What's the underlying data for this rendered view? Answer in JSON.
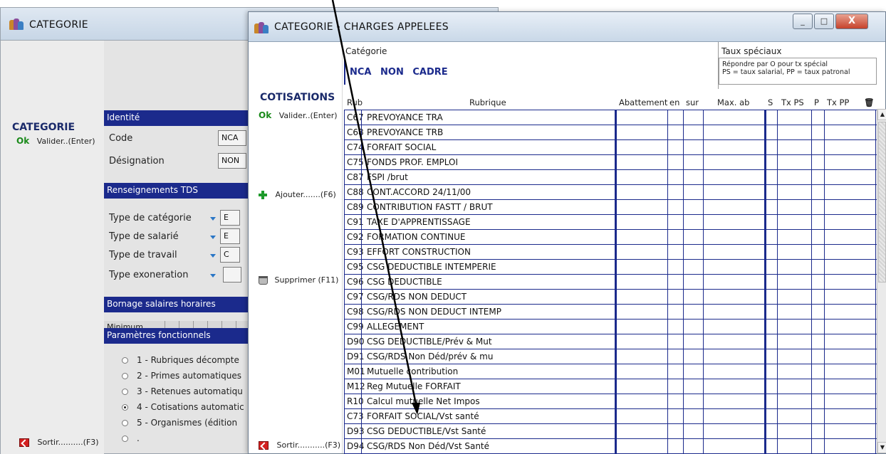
{
  "bg_window": {
    "title": "CATEGORIE",
    "left_title": "CATEGORIE",
    "valider_label": "Valider..(Enter)",
    "sortir_label": "Sortir..........(F3)",
    "ok_text": "Ok",
    "identite_header": "Identité",
    "code_label": "Code",
    "code_value": "NCA",
    "designation_label": "Désignation",
    "designation_value": "NON",
    "tds_header": "Renseignements TDS",
    "type_categorie_label": "Type de catégorie",
    "type_categorie_value": "E",
    "type_salarie_label": "Type de salarié",
    "type_salarie_value": "E",
    "type_travail_label": "Type de travail",
    "type_travail_value": "C",
    "type_exoneration_label": "Type exoneration",
    "type_exoneration_value": "",
    "bornage_header": "Bornage salaires horaires",
    "minimum_label": "Minimum",
    "params_header": "Paramètres fonctionnels",
    "params": [
      "1 - Rubriques décompte",
      "2 - Primes automatiques",
      "3 - Retenues automatiqu",
      "4 - Cotisations automatic",
      "5 - Organismes (édition",
      "."
    ]
  },
  "fg_window": {
    "title": "CATEGORIE - CHARGES APPELEES",
    "minimize_glyph": "_",
    "maximize_glyph": "□",
    "close_glyph": "X",
    "cotisations_title": "COTISATIONS",
    "ok_text": "Ok",
    "valider_label": "Valider..(Enter)",
    "ajouter_label": "Ajouter.......(F6)",
    "supprimer_label": "Supprimer (F11)",
    "sortir_label": "Sortir...........(F3)",
    "categorie_label": "Catégorie",
    "categorie_value": "NCA NON CADRE",
    "taux_title": "Taux spéciaux",
    "taux_line1": "Répondre par O pour tx spécial",
    "taux_line2": "PS = taux salarial, PP = taux patronal",
    "columns": {
      "rub": "Rub",
      "rubrique": "Rubrique",
      "abattement": "Abattement",
      "en": "en",
      "sur": "sur",
      "max_ab": "Max. ab",
      "s": "S",
      "txps": "Tx PS",
      "p": "P",
      "txpp": "Tx PP"
    },
    "rows": [
      {
        "code": "C67",
        "rubrique": "PREVOYANCE TRA"
      },
      {
        "code": "C68",
        "rubrique": "PREVOYANCE TRB"
      },
      {
        "code": "C74",
        "rubrique": "FORFAIT SOCIAL"
      },
      {
        "code": "C75",
        "rubrique": "FONDS PROF. EMPLOI"
      },
      {
        "code": "C87",
        "rubrique": "FSPI /brut"
      },
      {
        "code": "C88",
        "rubrique": "CONT.ACCORD 24/11/00"
      },
      {
        "code": "C89",
        "rubrique": "CONTRIBUTION FASTT / BRUT"
      },
      {
        "code": "C91",
        "rubrique": "TAXE D'APPRENTISSAGE"
      },
      {
        "code": "C92",
        "rubrique": "FORMATION CONTINUE"
      },
      {
        "code": "C93",
        "rubrique": "EFFORT CONSTRUCTION"
      },
      {
        "code": "C95",
        "rubrique": "CSG DEDUCTIBLE INTEMPERIE"
      },
      {
        "code": "C96",
        "rubrique": "CSG DEDUCTIBLE"
      },
      {
        "code": "C97",
        "rubrique": "CSG/RDS NON DEDUCT"
      },
      {
        "code": "C98",
        "rubrique": "CSG/RDS NON DEDUCT INTEMP"
      },
      {
        "code": "C99",
        "rubrique": "ALLEGEMENT"
      },
      {
        "code": "D90",
        "rubrique": "CSG DEDUCTIBLE/Prév & Mut"
      },
      {
        "code": "D91",
        "rubrique": "CSG/RDS Non Déd/prév & mu"
      },
      {
        "code": "M01",
        "rubrique": "Mutuelle contribution"
      },
      {
        "code": "M12",
        "rubrique": "Reg Mutuelle FORFAIT"
      },
      {
        "code": "R10",
        "rubrique": "Calcul mutuelle Net Impos"
      },
      {
        "code": "C73",
        "rubrique": "FORFAIT SOCIAL/Vst santé"
      },
      {
        "code": "D93",
        "rubrique": "CSG DEDUCTIBLE/Vst Santé"
      },
      {
        "code": "D94",
        "rubrique": "CSG/RDS Non Déd/Vst Santé"
      }
    ]
  },
  "colors": {
    "navy": "#1b2a8c",
    "ok_green": "#1a8a1a",
    "arrow": "#000000"
  },
  "icons": [
    "app-icon",
    "ok-icon",
    "plus-icon",
    "trash-icon",
    "exit-icon",
    "pointer-arrow"
  ]
}
